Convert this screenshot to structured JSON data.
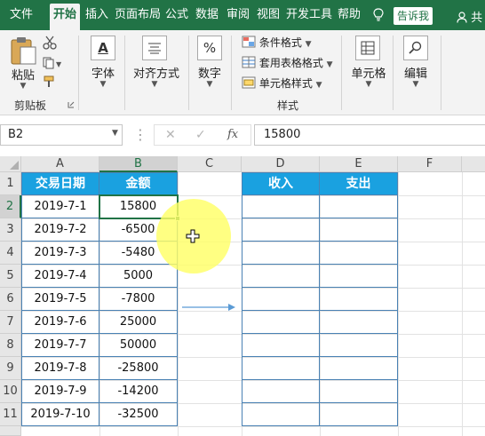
{
  "tabs": [
    "文件",
    "开始",
    "插入",
    "页面布局",
    "公式",
    "数据",
    "审阅",
    "视图",
    "开发工具",
    "帮助"
  ],
  "active_tab": "开始",
  "tell_me": "告诉我",
  "user": "共",
  "ribbon": {
    "paste": "粘贴",
    "clipboard": "剪贴板",
    "font": "字体",
    "alignment": "对齐方式",
    "number": "数字",
    "conditional_format": "条件格式",
    "table_format": "套用表格格式",
    "cell_styles": "单元格样式",
    "styles": "样式",
    "cells": "单元格",
    "editing": "编辑",
    "number_icon": "%",
    "font_icon": "A"
  },
  "formula_bar": {
    "name_box": "B2",
    "value": "15800",
    "cancel_icon": "✕",
    "enter_icon": "✓",
    "fx_label": "fx"
  },
  "columns": [
    "A",
    "B",
    "C",
    "D",
    "E",
    "F"
  ],
  "rows": [
    "1",
    "2",
    "3",
    "4",
    "5",
    "6",
    "7",
    "8",
    "9",
    "10",
    "11"
  ],
  "table1": {
    "headers": [
      "交易日期",
      "金额"
    ],
    "dates": [
      "2019-7-1",
      "2019-7-2",
      "2019-7-3",
      "2019-7-4",
      "2019-7-5",
      "2019-7-6",
      "2019-7-7",
      "2019-7-8",
      "2019-7-9",
      "2019-7-10"
    ],
    "amounts": [
      "15800",
      "-6500",
      "-5480",
      "5000",
      "-7800",
      "25000",
      "50000",
      "-25800",
      "-14200",
      "-32500"
    ]
  },
  "table2": {
    "headers": [
      "收入",
      "支出"
    ]
  },
  "colors": {
    "excel_green": "#217346",
    "header_blue": "#1aa1e0",
    "arrow_blue": "#5b9bd5",
    "highlight_yellow": "#ffff66"
  }
}
